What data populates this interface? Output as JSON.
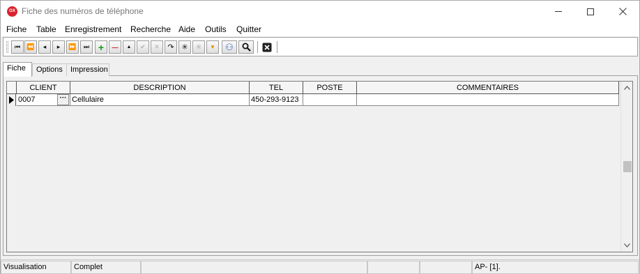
{
  "window": {
    "title": "Fiche des numéros de téléphone",
    "icon_text": "OX",
    "icon_color": "#d9232e"
  },
  "menu": [
    "Fiche",
    "Table",
    "Enregistrement",
    "Recherche",
    "Aide",
    "Outils",
    "Quitter"
  ],
  "toolbar": {
    "buttons": [
      {
        "name": "first-record-icon",
        "glyph": "⏮"
      },
      {
        "name": "prev-page-icon",
        "glyph": "⏪"
      },
      {
        "name": "prev-record-icon",
        "glyph": "◂"
      },
      {
        "name": "next-record-icon",
        "glyph": "▸"
      },
      {
        "name": "next-page-icon",
        "glyph": "⏩"
      },
      {
        "name": "last-record-icon",
        "glyph": "⏭"
      },
      {
        "name": "add-icon",
        "glyph": "+"
      },
      {
        "name": "delete-icon",
        "glyph": "—"
      },
      {
        "name": "edit-icon",
        "glyph": "▲"
      },
      {
        "name": "post-icon",
        "glyph": "✔"
      },
      {
        "name": "cancel-edit-icon",
        "glyph": "✕"
      },
      {
        "name": "refresh-icon",
        "glyph": "↷"
      },
      {
        "name": "asterisk-icon",
        "glyph": "✳"
      },
      {
        "name": "asterisk-disabled-icon",
        "glyph": "✳"
      },
      {
        "name": "filter-icon",
        "glyph": "▼"
      },
      {
        "name": "binoculars-icon",
        "glyph": "⚇"
      },
      {
        "name": "search-icon",
        "glyph": "🔍"
      },
      {
        "name": "close-form-icon",
        "glyph": "✖"
      }
    ],
    "colors": {
      "add": "#1a9a1a",
      "delete": "#cc1111",
      "filter": "#e08a00",
      "binoculars": "#2a5fb0"
    }
  },
  "tabs": [
    "Fiche",
    "Options",
    "Impression"
  ],
  "grid": {
    "columns": [
      "CLIENT",
      "DESCRIPTION",
      "TEL",
      "POSTE",
      "COMMENTAIRES"
    ],
    "rows": [
      {
        "client": "0007",
        "description": "Cellulaire",
        "tel": "450-293-9123",
        "poste": "",
        "commentaires": ""
      }
    ]
  },
  "status": {
    "mode": "Visualisation",
    "state": "Complet",
    "info": "AP- [1]."
  }
}
